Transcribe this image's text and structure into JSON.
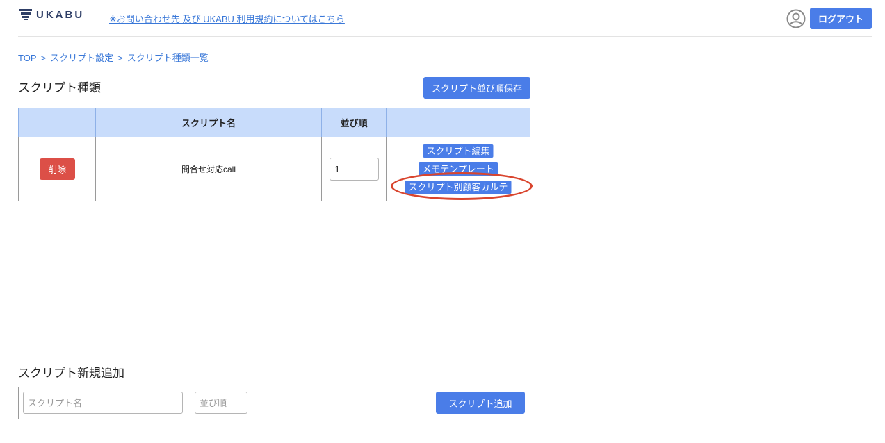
{
  "header": {
    "logo_text": "UKABU",
    "help_link": "※お問い合わせ先 及び UKABU 利用規約についてはこちら",
    "logout_label": "ログアウト",
    "user_icon": "user-circle-icon"
  },
  "breadcrumb": {
    "items": [
      "TOP",
      "スクリプト設定",
      "スクリプト種類一覧"
    ],
    "separator": ">"
  },
  "scripts_section": {
    "title": "スクリプト種類",
    "save_order_label": "スクリプト並び順保存",
    "columns": [
      "",
      "スクリプト名",
      "並び順",
      ""
    ],
    "rows": [
      {
        "delete_label": "削除",
        "name": "問合せ対応call",
        "order": "1",
        "actions": [
          "スクリプト編集",
          "メモテンプレート",
          "スクリプト別顧客カルテ"
        ]
      }
    ]
  },
  "add_section": {
    "title": "スクリプト新規追加",
    "name_placeholder": "スクリプト名",
    "order_placeholder": "並び順",
    "add_label": "スクリプト追加"
  },
  "colors": {
    "primary": "#4a7de8",
    "danger": "#dc4f47",
    "table_header": "#c8dcfb",
    "highlight": "#d9452e"
  }
}
